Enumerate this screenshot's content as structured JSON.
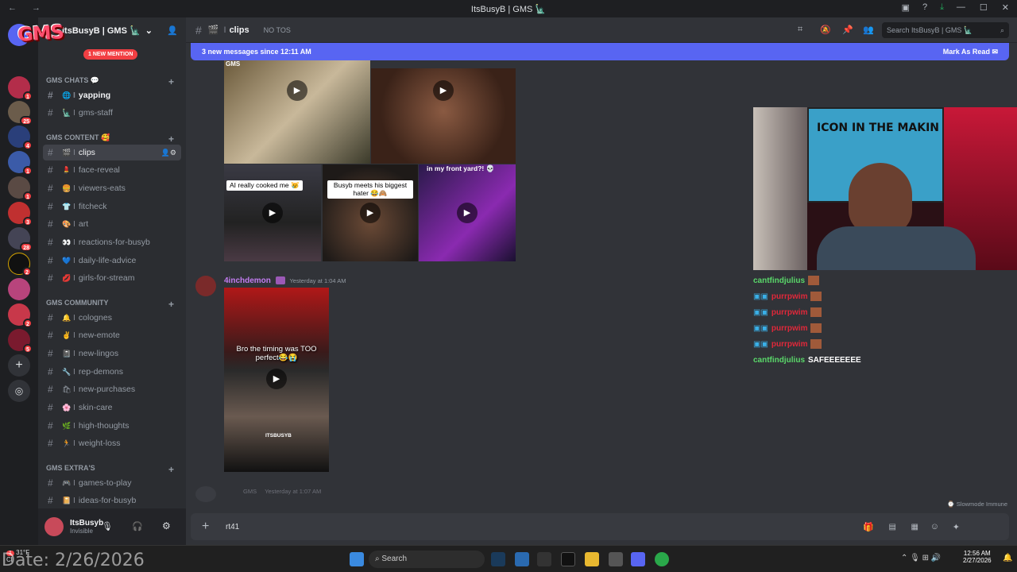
{
  "window": {
    "title": "ItsBusyB | GMS 🗽"
  },
  "server": {
    "name": "ItsBusyB | GMS 🗽",
    "logo_text": "GMS",
    "mention_pill": "1 NEW MENTION"
  },
  "guild_badges": [
    "1",
    "25",
    "4",
    "1",
    "1",
    "3",
    "28",
    "2",
    "2",
    "5"
  ],
  "categories": {
    "chats": "GMS CHATS 💬",
    "content": "GMS CONTENT 🥰",
    "community": "GMS COMMUNITY",
    "extras": "GMS EXTRA'S"
  },
  "channels": {
    "yapping": "yapping",
    "gms_staff": "gms-staff",
    "clips": "clips",
    "face_reveal": "face-reveal",
    "viewers_eats": "viewers-eats",
    "fitcheck": "fitcheck",
    "art": "art",
    "reactions": "reactions-for-busyb",
    "daily_life": "daily-life-advice",
    "girls": "girls-for-stream",
    "colognes": "colognes",
    "new_emote": "new-emote",
    "new_lingos": "new-lingos",
    "rep_demons": "rep-demons",
    "new_purchases": "new-purchases",
    "skin_care": "skin-care",
    "high_thoughts": "high-thoughts",
    "weight_loss": "weight-loss",
    "games": "games-to-play",
    "ideas": "ideas-for-busyb"
  },
  "user": {
    "name": "ItsBusyb",
    "status": "Invisible"
  },
  "header": {
    "channel": "clips",
    "topic": "NO TOS",
    "search_placeholder": "Search ItsBusyB | GMS 🗽"
  },
  "new_messages": {
    "text": "3 new messages since 12:11 AM",
    "mark_read": "Mark As Read"
  },
  "message1": {
    "captions": {
      "ai": "AI really cooked me 😿",
      "busyb": "Busyb meets his biggest hater 😂🙈",
      "yard": "in my front yard?! 💀"
    },
    "corner_tag": "GMS"
  },
  "message2": {
    "author": "4inchdemon",
    "timestamp": "Yesterday at 1:04 AM",
    "caption": "Bro the timing was TOO perfect😂😭",
    "watermark": "ITSBUSYB"
  },
  "message3": {
    "tag": "GMS",
    "timestamp": "Yesterday at 1:07 AM"
  },
  "composer": {
    "text": "rt41",
    "slowmode": "Slowmode Immune"
  },
  "stream": {
    "banner": "ICON IN THE MAKIN"
  },
  "chat_overlay": [
    {
      "user": "cantfindjulius",
      "text": ""
    },
    {
      "user": "purrpwim",
      "text": ""
    },
    {
      "user": "purrpwim",
      "text": ""
    },
    {
      "user": "purrpwim",
      "text": ""
    },
    {
      "user": "purrpwim",
      "text": ""
    },
    {
      "user": "cantfindjulius",
      "text": "SAFEEEEEEE"
    }
  ],
  "taskbar": {
    "search": "Search",
    "weather_temp": "31°F",
    "weather_sub": "Cl",
    "weather_badge": "1",
    "time": "12:56 AM",
    "date": "2/27/2026",
    "overlay_date": "Date: 2/26/2026"
  },
  "colors": {
    "accent": "#5865f2",
    "mention": "#f23f43",
    "bg": "#313338"
  }
}
